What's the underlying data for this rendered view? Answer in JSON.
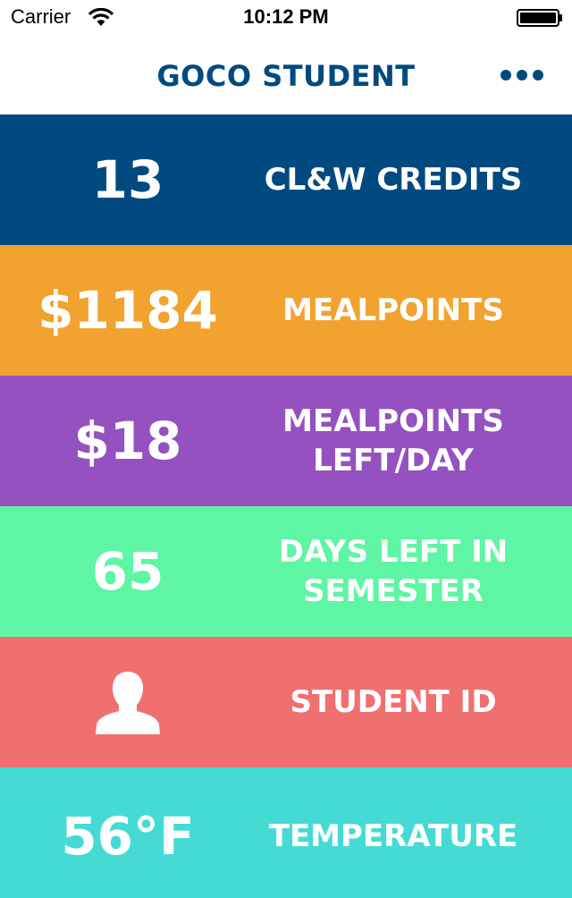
{
  "status_bar": {
    "carrier": "Carrier",
    "time": "10:12 PM",
    "wifi_icon": "wifi-icon",
    "battery_icon": "battery-icon"
  },
  "nav": {
    "title": "GOCO STUDENT",
    "more_icon": "more-dots-icon"
  },
  "colors": {
    "brand_blue": "#004a80",
    "tile_credits": "#004a80",
    "tile_mealpoints": "#f2a22f",
    "tile_mealpoints_day": "#9451bf",
    "tile_days_left": "#5ef5a4",
    "tile_student_id": "#f07070",
    "tile_temperature": "#45dbd4"
  },
  "tiles": [
    {
      "value": "13",
      "label": "CL&W CREDITS"
    },
    {
      "value": "$1184",
      "label": "MEALPOINTS"
    },
    {
      "value": "$18",
      "label": "MEALPOINTS\nLEFT/DAY"
    },
    {
      "value": "65",
      "label": "DAYS LEFT IN\nSEMESTER"
    },
    {
      "icon": "person-icon",
      "label": "STUDENT ID"
    },
    {
      "value": "56°F",
      "label": "TEMPERATURE"
    }
  ]
}
